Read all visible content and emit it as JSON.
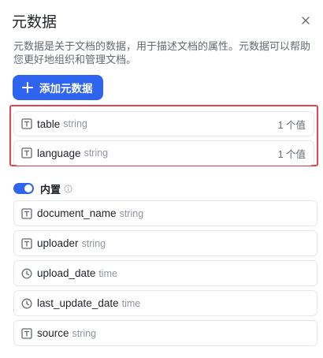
{
  "panel": {
    "title": "元数据",
    "description": "元数据是关于文档的数据，用于描述文档的属性。元数据可以帮助您更好地组织和管理文档。",
    "add_button_label": "添加元数据"
  },
  "custom_fields": [
    {
      "name": "table",
      "type": "string",
      "count": "1 个值",
      "icon": "text-field-icon"
    },
    {
      "name": "language",
      "type": "string",
      "count": "1 个值",
      "icon": "text-field-icon"
    }
  ],
  "builtin": {
    "label": "内置",
    "toggle_on": true,
    "fields": [
      {
        "name": "document_name",
        "type": "string",
        "icon": "text-field-icon"
      },
      {
        "name": "uploader",
        "type": "string",
        "icon": "text-field-icon"
      },
      {
        "name": "upload_date",
        "type": "time",
        "icon": "clock-icon"
      },
      {
        "name": "last_update_date",
        "type": "time",
        "icon": "clock-icon"
      },
      {
        "name": "source",
        "type": "string",
        "icon": "text-field-icon"
      }
    ]
  },
  "colors": {
    "accent": "#2f64f0",
    "highlight_border": "#e0464e"
  }
}
